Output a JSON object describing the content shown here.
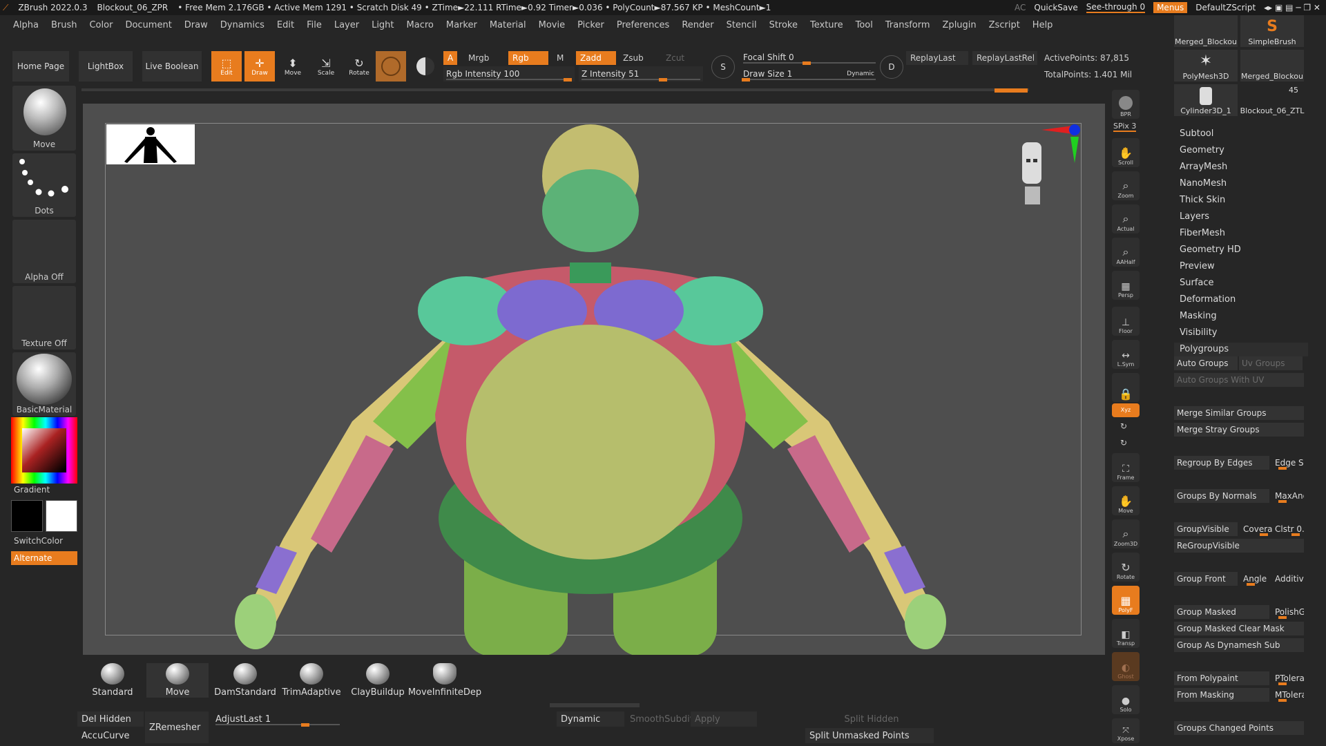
{
  "titlebar": {
    "app": "ZBrush 2022.0.3",
    "file": "Blockout_06_ZPR",
    "stats": "• Free Mem 2.176GB • Active Mem 1291 • Scratch Disk 49 • ZTime►22.111 RTime►0.92 Timer►0.036 • PolyCount►87.567 KP • MeshCount►1",
    "ac": "AC",
    "quicksave": "QuickSave",
    "seethrough": "See-through   0",
    "menus": "Menus",
    "script": "DefaultZScript"
  },
  "menu": [
    "Alpha",
    "Brush",
    "Color",
    "Document",
    "Draw",
    "Dynamics",
    "Edit",
    "File",
    "Layer",
    "Light",
    "Macro",
    "Marker",
    "Material",
    "Movie",
    "Picker",
    "Preferences",
    "Render",
    "Stencil",
    "Stroke",
    "Texture",
    "Tool",
    "Transform",
    "Zplugin",
    "Zscript",
    "Help"
  ],
  "toolbar": {
    "home": "Home Page",
    "lightbox": "LightBox",
    "liveboolean": "Live Boolean",
    "edit": "Edit",
    "draw": "Draw",
    "move": "Move",
    "scale": "Scale",
    "rotate": "Rotate",
    "a": "A",
    "mrgb": "Mrgb",
    "rgb": "Rgb",
    "m": "M",
    "zadd": "Zadd",
    "zsub": "Zsub",
    "zcut": "Zcut",
    "rgb_intensity": "Rgb Intensity 100",
    "z_intensity": "Z Intensity 51",
    "focal": "Focal Shift 0",
    "drawsize": "Draw Size 1",
    "dynamic": "Dynamic",
    "replaylast": "ReplayLast",
    "replaylastrel": "ReplayLastRel",
    "activepoints": "ActivePoints: 87,815",
    "totalpoints": "TotalPoints: 1.401 Mil"
  },
  "leftshelf": {
    "move": "Move",
    "dots": "Dots",
    "alpha": "Alpha Off",
    "texture": "Texture Off",
    "material": "BasicMaterial",
    "gradient": "Gradient",
    "switchcolor": "SwitchColor",
    "alternate": "Alternate"
  },
  "canvasstrip": [
    "BPR",
    "SPix 3",
    "Scroll",
    "Zoom",
    "Actual",
    "AAHalf",
    "Persp",
    "Floor",
    "L.Sym",
    "",
    "Xyz",
    "",
    "",
    "Frame",
    "Move",
    "Zoom3D",
    "Rotate",
    "PolyF",
    "Transp",
    "Ghost",
    "Solo",
    "Xpose"
  ],
  "rightpanel": {
    "tools": [
      "Merged_Blockou",
      "SimpleBrush",
      "PolyMesh3D",
      "Merged_Blockou",
      "Cylinder3D_1",
      "Blockout_06_ZTL"
    ],
    "tool_count": "45",
    "menu": [
      "Subtool",
      "Geometry",
      "ArrayMesh",
      "NanoMesh",
      "Thick Skin",
      "Layers",
      "FiberMesh",
      "Geometry HD",
      "Preview",
      "Surface",
      "Deformation",
      "Masking",
      "Visibility",
      "Polygroups"
    ],
    "poly": {
      "auto_groups": "Auto Groups",
      "uv_groups": "Uv Groups",
      "auto_groups_uv": "Auto Groups With UV",
      "merge_similar": "Merge Similar Groups",
      "merge_stray": "Merge Stray Groups",
      "regroup_edges": "Regroup By Edges",
      "edge_se": "Edge Se",
      "groups_normals": "Groups By Normals",
      "maxang": "MaxAng",
      "groupvisible": "GroupVisible",
      "coverage": "Coverag",
      "clstr": "Clstr 0.",
      "regroupvisible": "ReGroupVisible",
      "group_front": "Group Front",
      "angle": "Angle",
      "additive": "Additive",
      "group_masked": "Group Masked",
      "polishg": "PolishG",
      "group_masked_clear": "Group Masked Clear Mask",
      "group_dynamesh": "Group As Dynamesh Sub",
      "from_polypaint": "From Polypaint",
      "ptolera": "PTolera",
      "from_masking": "From Masking",
      "mtolera": "MTolera",
      "groups_changed": "Groups Changed Points"
    }
  },
  "bottomshelf": {
    "brushes": [
      "Standard",
      "Move",
      "DamStandard",
      "TrimAdaptive",
      "ClayBuildup",
      "MoveInfiniteDep"
    ],
    "del_hidden": "Del Hidden",
    "accucurve": "AccuCurve",
    "zremesher": "ZRemesher",
    "adjustlast": "AdjustLast 1",
    "dynamic": "Dynamic",
    "smoothsubdiv": "SmoothSubdiv",
    "apply": "Apply",
    "split_hidden": "Split Hidden",
    "split_unmasked": "Split Unmasked Points"
  },
  "colors": {
    "accent": "#e87c1e",
    "bg": "#262626",
    "viewport": "#4e4e4e"
  }
}
